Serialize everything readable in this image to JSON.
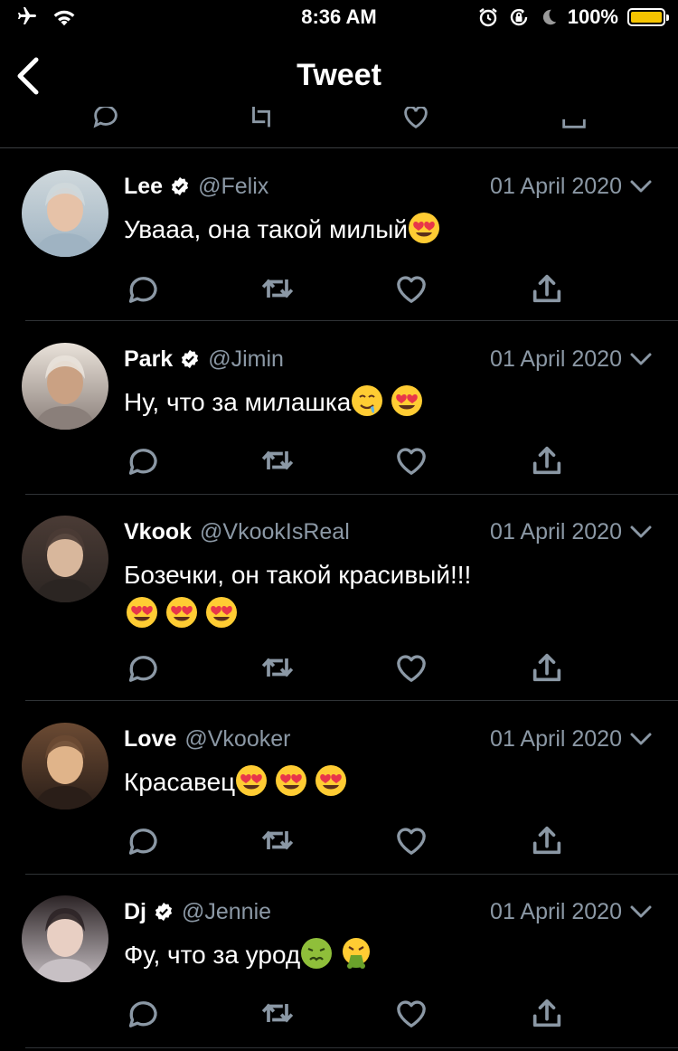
{
  "status_bar": {
    "time": "8:36 AM",
    "battery_percent": "100%",
    "battery_level": 1.0,
    "battery_color": "#f5c400"
  },
  "nav": {
    "title": "Tweet"
  },
  "colors": {
    "background": "#000000",
    "secondary_text": "#8b98a5",
    "separator": "#2f3336"
  },
  "tweets": [
    {
      "name": "Lee",
      "verified": true,
      "handle": "@Felix",
      "date": "01 April 2020",
      "text": "Уваaa, она такой милый",
      "emojis": [
        "heart-eyes"
      ]
    },
    {
      "name": "Park",
      "verified": true,
      "handle": "@Jimin",
      "date": "01 April 2020",
      "text": "Ну, что за милашка",
      "emojis": [
        "drooling",
        "heart-eyes"
      ]
    },
    {
      "name": "Vkook",
      "verified": false,
      "handle": "@VkookIsReal",
      "date": "01 April 2020",
      "text": "Бозечки, он такой красивый!!!",
      "emojis": [
        "heart-eyes",
        "heart-eyes",
        "heart-eyes"
      ]
    },
    {
      "name": "Love",
      "verified": false,
      "handle": "@Vkooker",
      "date": "01 April 2020",
      "text": "Красавец",
      "emojis": [
        "heart-eyes",
        "heart-eyes",
        "heart-eyes"
      ]
    },
    {
      "name": "Dj",
      "verified": true,
      "handle": "@Jennie",
      "date": "01 April 2020",
      "text": "Фу, что за урод",
      "emojis": [
        "nauseated",
        "vomiting"
      ]
    }
  ]
}
